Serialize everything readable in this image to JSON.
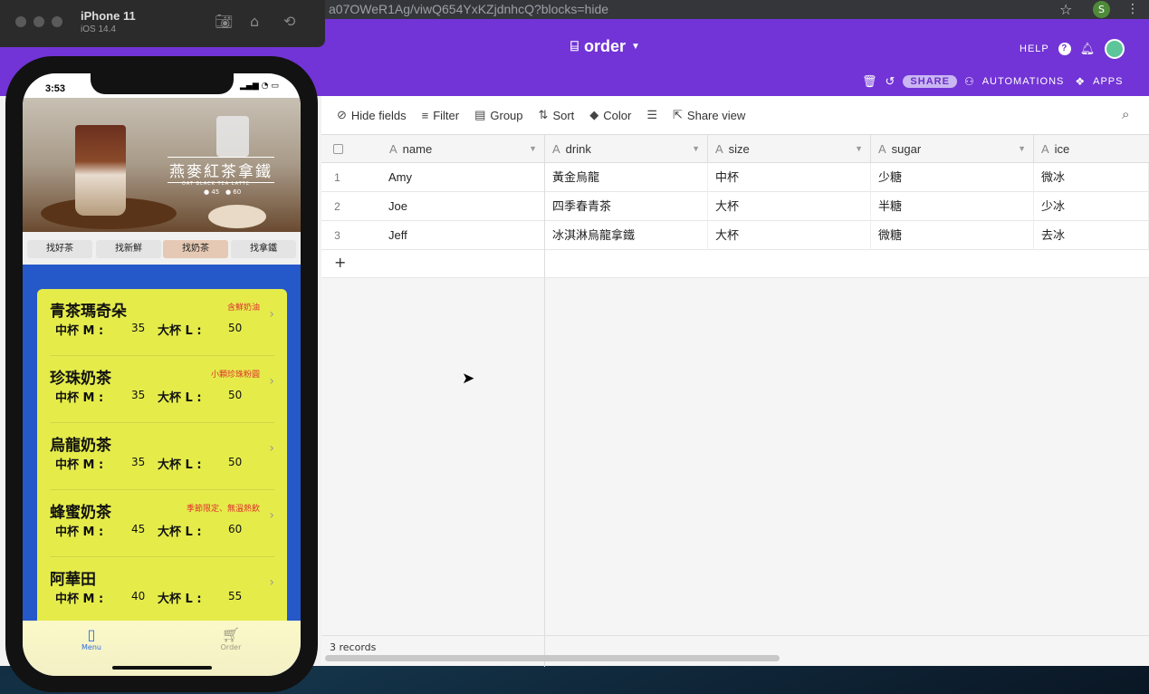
{
  "browser": {
    "url": "a07OWeR1Ag/viwQ654YxKZjdnhcQ?blocks=hide",
    "profile_initial": "S"
  },
  "airtable": {
    "table_name": "order",
    "help_label": "HELP",
    "share_label": "SHARE",
    "automations_label": "AUTOMATIONS",
    "apps_label": "APPS",
    "toolbar": {
      "hide_fields": "Hide fields",
      "filter": "Filter",
      "group": "Group",
      "sort": "Sort",
      "color": "Color",
      "share_view": "Share view"
    },
    "columns": [
      "name",
      "drink",
      "size",
      "sugar",
      "ice"
    ],
    "rows": [
      {
        "num": "1",
        "name": "Amy",
        "drink": "黃金烏龍",
        "size": "中杯",
        "sugar": "少糖",
        "ice": "微冰"
      },
      {
        "num": "2",
        "name": "Joe",
        "drink": "四季春青茶",
        "size": "大杯",
        "sugar": "半糖",
        "ice": "少冰"
      },
      {
        "num": "3",
        "name": "Jeff",
        "drink": "冰淇淋烏龍拿鐵",
        "size": "大杯",
        "sugar": "微糖",
        "ice": "去冰"
      }
    ],
    "records_label": "3 records",
    "add_row": "+"
  },
  "simulator": {
    "device": "iPhone 11",
    "os": "iOS 14.4"
  },
  "phone": {
    "time": "3:53",
    "banner_title": "燕麥紅茶拿鐵",
    "banner_sub": "OAT BLACK TEA LATTE",
    "banner_price_m": "45",
    "banner_price_l": "60",
    "tabs": [
      "找好茶",
      "找新鮮",
      "找奶茶",
      "找拿鐵"
    ],
    "selected_tab": "找奶茶",
    "medium_label": "中杯 M :",
    "large_label": "大杯 L :",
    "items": [
      {
        "name": "青茶瑪奇朵",
        "note": "含鮮奶油",
        "m": "35",
        "l": "50"
      },
      {
        "name": "珍珠奶茶",
        "note": "小顆珍珠粉圓",
        "m": "35",
        "l": "50"
      },
      {
        "name": "烏龍奶茶",
        "note": "",
        "m": "35",
        "l": "50"
      },
      {
        "name": "蜂蜜奶茶",
        "note": "季節限定、無溫熱飲",
        "m": "45",
        "l": "60"
      },
      {
        "name": "阿華田",
        "note": "",
        "m": "40",
        "l": "55"
      }
    ],
    "tabbar": {
      "menu": "Menu",
      "order": "Order"
    },
    "colors": {
      "menu_bg": "#2558c9",
      "card_bg": "#e5ec4a",
      "note": "#e03030"
    }
  }
}
